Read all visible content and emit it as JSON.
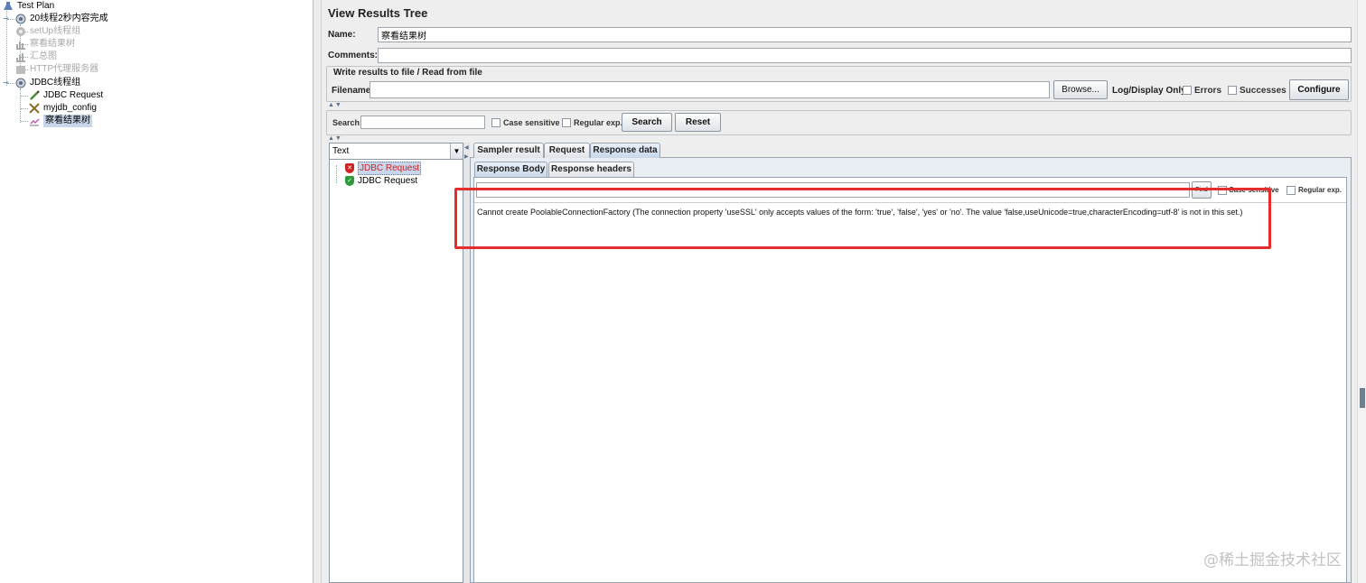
{
  "tree": {
    "items": [
      {
        "label": "Test Plan",
        "icon": "flask-icon",
        "state": "normal"
      },
      {
        "label": "20线程2秒内容完成",
        "icon": "thread-group-icon",
        "state": "normal"
      },
      {
        "label": "setUp线程组",
        "icon": "gear-icon",
        "state": "disabled"
      },
      {
        "label": "察看结果树",
        "icon": "chart-icon",
        "state": "disabled"
      },
      {
        "label": "汇总图",
        "icon": "chart-icon",
        "state": "disabled"
      },
      {
        "label": "HTTP代理服务器",
        "icon": "proxy-icon",
        "state": "disabled"
      },
      {
        "label": "JDBC线程组",
        "icon": "thread-group-icon",
        "state": "normal"
      },
      {
        "label": "JDBC Request",
        "icon": "pipette-icon",
        "state": "normal"
      },
      {
        "label": "myjdb_config",
        "icon": "wrench-icon",
        "state": "normal"
      },
      {
        "label": "察看结果树",
        "icon": "chart-icon",
        "state": "selected"
      }
    ]
  },
  "panel": {
    "title": "View Results Tree",
    "name_label": "Name:",
    "name_value": "察看结果树",
    "comments_label": "Comments:",
    "comments_value": "",
    "file_group_title": "Write results to file / Read from file",
    "filename_label": "Filename",
    "filename_value": "",
    "browse_label": "Browse...",
    "log_display_label": "Log/Display Only:",
    "errors_label": "Errors",
    "successes_label": "Successes",
    "configure_label": "Configure"
  },
  "search": {
    "label": "Search:",
    "value": "",
    "case_sensitive_label": "Case sensitive",
    "regex_label": "Regular exp.",
    "search_button": "Search",
    "reset_button": "Reset"
  },
  "results": {
    "renderer": "Text",
    "items": [
      {
        "label": "JDBC Request",
        "status": "error"
      },
      {
        "label": "JDBC Request",
        "status": "success"
      }
    ]
  },
  "tabs": {
    "main": [
      "Sampler result",
      "Request",
      "Response data"
    ],
    "sub": [
      "Response Body",
      "Response headers"
    ]
  },
  "response": {
    "find_label": "Find",
    "find_value": "",
    "case_sensitive_label": "Case sensitive",
    "regex_label": "Regular exp.",
    "body": "Cannot create PoolableConnectionFactory (The connection property 'useSSL' only accepts values of the form: 'true', 'false', 'yes' or 'no'. The value 'false,useUnicode=true,characterEncoding=utf-8' is not in this set.)"
  },
  "watermark": "@稀土掘金技术社区",
  "colors": {
    "highlight": "#e52d2d",
    "error_icon": "#cc2222",
    "success_icon": "#2e9a3a",
    "selection": "#c7d6ea"
  }
}
